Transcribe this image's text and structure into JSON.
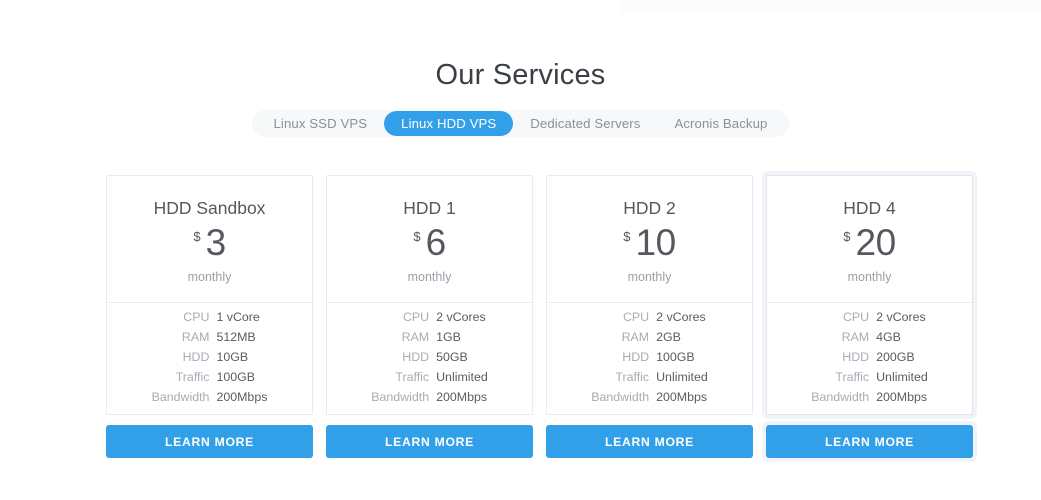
{
  "section": {
    "title": "Our Services"
  },
  "tabs": {
    "items": [
      {
        "label": "Linux SSD VPS",
        "active": false
      },
      {
        "label": "Linux HDD VPS",
        "active": true
      },
      {
        "label": "Dedicated Servers",
        "active": false
      },
      {
        "label": "Acronis Backup",
        "active": false
      }
    ],
    "active_index": 1
  },
  "colors": {
    "accent": "#32a0e8",
    "card_border": "#e9ebee",
    "heading_text": "#3a3f45",
    "label_text": "#a6adb5",
    "value_text": "#585d63",
    "tabs_background": "#f7f8fa"
  },
  "spec_labels": [
    "CPU",
    "RAM",
    "HDD",
    "Traffic",
    "Bandwidth"
  ],
  "button_label": "LEARN MORE",
  "currency_symbol": "$",
  "period_label": "monthly",
  "plans": [
    {
      "name": "HDD Sandbox",
      "currency": "$",
      "price": "3",
      "period": "monthly",
      "highlighted": false,
      "specs": [
        {
          "label": "CPU",
          "value": "1 vCore"
        },
        {
          "label": "RAM",
          "value": "512MB"
        },
        {
          "label": "HDD",
          "value": "10GB"
        },
        {
          "label": "Traffic",
          "value": "100GB"
        },
        {
          "label": "Bandwidth",
          "value": "200Mbps"
        }
      ],
      "button": "LEARN MORE"
    },
    {
      "name": "HDD 1",
      "currency": "$",
      "price": "6",
      "period": "monthly",
      "highlighted": false,
      "specs": [
        {
          "label": "CPU",
          "value": "2 vCores"
        },
        {
          "label": "RAM",
          "value": "1GB"
        },
        {
          "label": "HDD",
          "value": "50GB"
        },
        {
          "label": "Traffic",
          "value": "Unlimited"
        },
        {
          "label": "Bandwidth",
          "value": "200Mbps"
        }
      ],
      "button": "LEARN MORE"
    },
    {
      "name": "HDD 2",
      "currency": "$",
      "price": "10",
      "period": "monthly",
      "highlighted": false,
      "specs": [
        {
          "label": "CPU",
          "value": "2 vCores"
        },
        {
          "label": "RAM",
          "value": "2GB"
        },
        {
          "label": "HDD",
          "value": "100GB"
        },
        {
          "label": "Traffic",
          "value": "Unlimited"
        },
        {
          "label": "Bandwidth",
          "value": "200Mbps"
        }
      ],
      "button": "LEARN MORE"
    },
    {
      "name": "HDD 4",
      "currency": "$",
      "price": "20",
      "period": "monthly",
      "highlighted": true,
      "specs": [
        {
          "label": "CPU",
          "value": "2 vCores"
        },
        {
          "label": "RAM",
          "value": "4GB"
        },
        {
          "label": "HDD",
          "value": "200GB"
        },
        {
          "label": "Traffic",
          "value": "Unlimited"
        },
        {
          "label": "Bandwidth",
          "value": "200Mbps"
        }
      ],
      "button": "LEARN MORE"
    }
  ]
}
